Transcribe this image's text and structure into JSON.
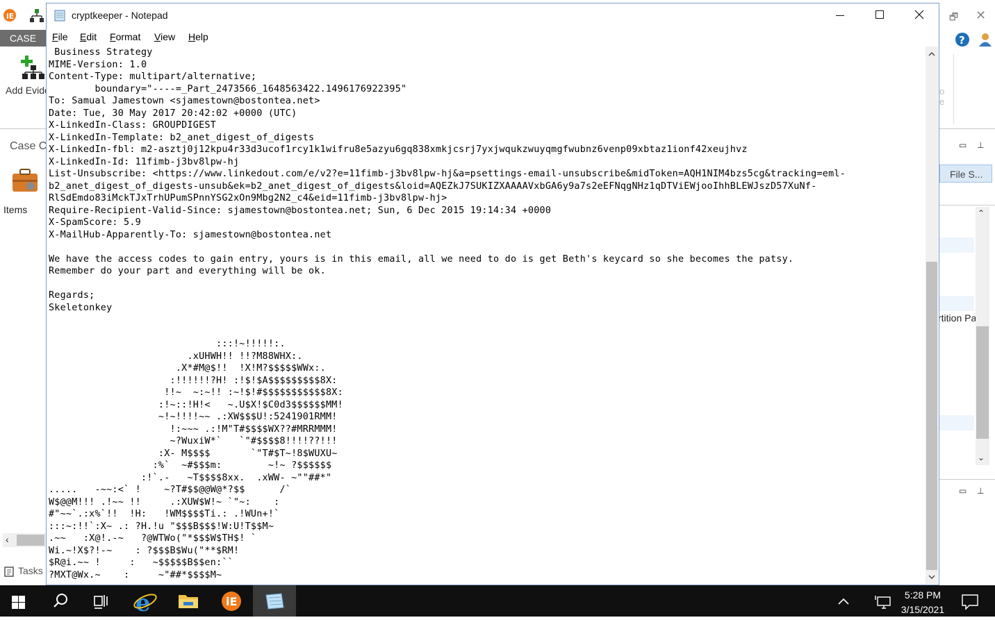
{
  "background_app": {
    "case_tab": "CASE",
    "add_evidence_label": "Add Evide",
    "case_label": "Case C",
    "items_label": "Items",
    "tasks_label": "Tasks",
    "file_tab_label": "File S...",
    "partition_label": "rtition Pa",
    "o_e_text": "o\ne"
  },
  "notepad": {
    "title": "cryptkeeper - Notepad",
    "menu": [
      {
        "label": "File",
        "accel": "F",
        "rest": "ile"
      },
      {
        "label": "Edit",
        "accel": "E",
        "rest": "dit"
      },
      {
        "label": "Format",
        "accel": "F",
        "rest": "ormat"
      },
      {
        "label": "View",
        "accel": "V",
        "rest": "iew"
      },
      {
        "label": "Help",
        "accel": "H",
        "rest": "elp"
      }
    ],
    "content": " Business Strategy\nMIME-Version: 1.0\nContent-Type: multipart/alternative;\n        boundary=\"----=_Part_2473566_1648563422.1496176922395\"\nTo: Samual Jamestown <sjamestown@bostontea.net>\nDate: Tue, 30 May 2017 20:42:02 +0000 (UTC)\nX-LinkedIn-Class: GROUPDIGEST\nX-LinkedIn-Template: b2_anet_digest_of_digests\nX-LinkedIn-fbl: m2-asztj0j12kpu4r33d3ucof1rcy1k1wifru8e5azyu6gq838xmkjcsrj7yxjwqukzwuyqmgfwubnz6venp09xbtaz1ionf42xeujhvz\nX-LinkedIn-Id: 11fimb-j3bv8lpw-hj\nList-Unsubscribe: <https://www.linkedout.com/e/v2?e=11fimb-j3bv8lpw-hj&a=psettings-email-unsubscribe&midToken=AQH1NIM4bzs5cg&tracking=eml-\nb2_anet_digest_of_digests-unsub&ek=b2_anet_digest_of_digests&loid=AQEZkJ7SUKIZXAAAAVxbGA6y9a7s2eEFNqgNHz1qDTViEWjooIhhBLEWJszD57XuNf-\nRlSdEmdo83iMckTJxTrhUPumSPnnYSG2xOn9Mbg2N2_c4&eid=11fimb-j3bv8lpw-hj>\nRequire-Recipient-Valid-Since: sjamestown@bostontea.net; Sun, 6 Dec 2015 19:14:34 +0000\nX-SpamScore: 5.9\nX-MailHub-Apparently-To: sjamestown@bostontea.net\n\nWe have the access codes to gain entry, yours is in this email, all we need to do is get Beth's keycard so she becomes the patsy.\nRemember do your part and everything will be ok.\n\nRegards;\nSkeletonkey\n\n\n                             :::!~!!!!!:.\n                        .xUHWH!! !!?M88WHX:.\n                      .X*#M@$!!  !X!M?$$$$$WWx:.\n                     :!!!!!!?H! :!$!$A$$$$$$$$$8X:\n                    !!~  ~:~!! :~!$!#$$$$$$$$$$$8X:\n                   :!~::!H!<   ~.U$X!$C0d3$$$$$$MM!\n                   ~!~!!!!~~ .:XW$$$U!:5241901RMM!\n                     !:~~~ .:!M\"T#$$$$WX??#MRRMMM!\n                     ~?WuxiW*`   `\"#$$$$8!!!!??!!!\n                   :X- M$$$$       `\"T#$T~!8$WUXU~\n                  :%`  ~#$$$m:        ~!~ ?$$$$$$\n                :!`.-   ~T$$$$8xx.  .xWW- ~\"\"##*\"\n.....   -~~:<` !    ~?T#$$@@W@*?$$      /`\nW$@@M!!! .!~~ !!     .:XUW$W!~ `\"~:    :\n#\"~~`.:x%`!!  !H:   !WM$$$$Ti.: .!WUn+!`\n:::~:!!`:X~ .: ?H.!u \"$$$B$$$!W:U!T$$M~\n.~~   :X@!.-~   ?@WTWo(\"*$$$W$TH$! `\nWi.~!X$?!-~    : ?$$$B$Wu(\"**$RM!\n$R@i.~~ !     :   ~$$$$$B$$en:``\n?MXT@Wx.~    :     ~\"##*$$$$M~"
  },
  "taskbar": {
    "time": "5:28 PM",
    "date": "3/15/2021"
  },
  "colors": {
    "taskbar_bg": "#101010",
    "case_tab_bg": "#6d6d6d",
    "window_border": "#7a9cc4"
  }
}
